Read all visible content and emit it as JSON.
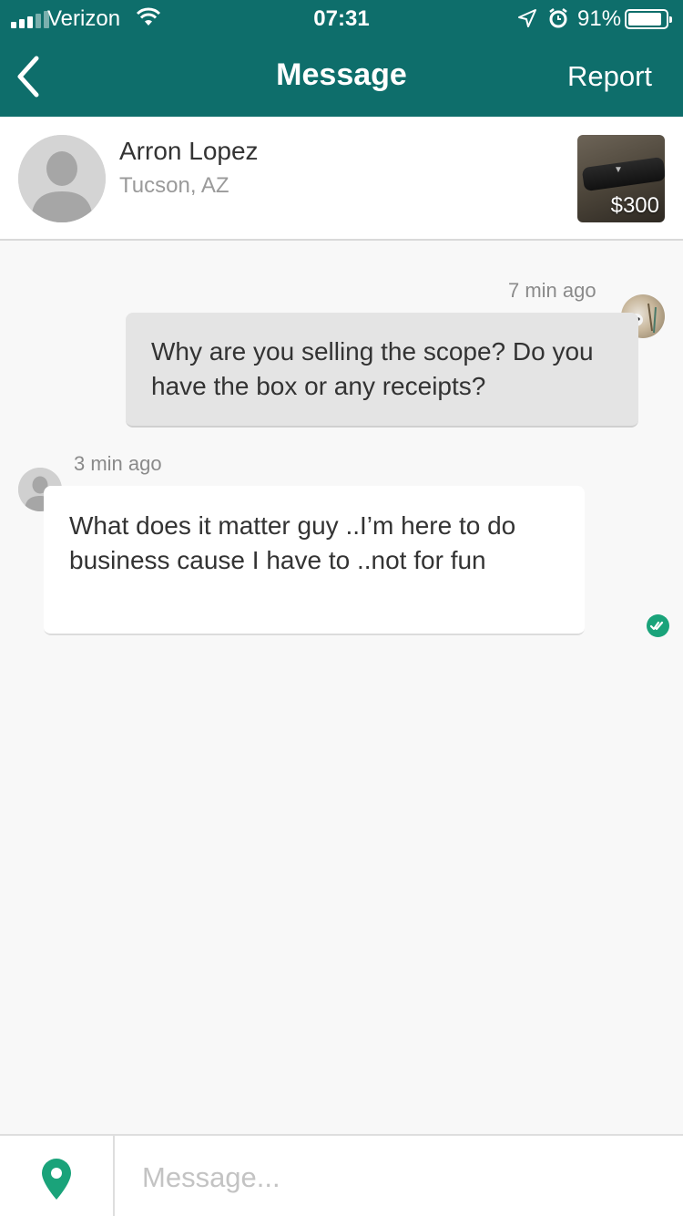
{
  "status_bar": {
    "carrier": "Verizon",
    "time": "07:31",
    "battery_percent": "91%",
    "battery_level": 0.91
  },
  "nav": {
    "title": "Message",
    "back_icon": "chevron-left-icon",
    "report_label": "Report"
  },
  "contact": {
    "name": "Arron Lopez",
    "location": "Tucson, AZ"
  },
  "listing": {
    "price": "$300"
  },
  "messages": [
    {
      "direction": "outgoing",
      "time": "7 min ago",
      "text": "Why are you selling the scope? Do you have the box or any receipts?"
    },
    {
      "direction": "incoming",
      "time": "3 min ago",
      "text": "What does it matter guy ..I’m here to do business cause I have to ..not for fun"
    }
  ],
  "composer": {
    "placeholder": "Message...",
    "value": ""
  },
  "colors": {
    "header": "#0e6e6b",
    "accent": "#1aa37a"
  }
}
